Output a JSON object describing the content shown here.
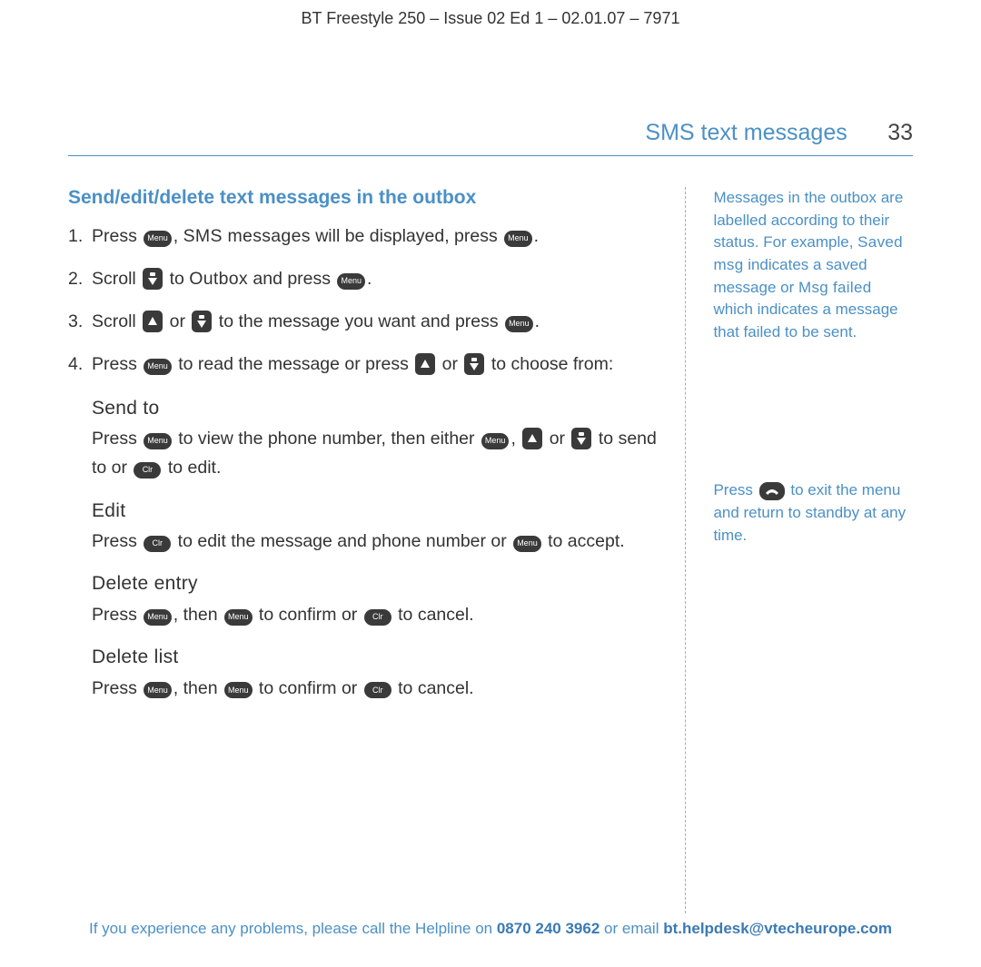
{
  "header": "BT Freestyle 250 – Issue 02 Ed 1 – 02.01.07 – 7971",
  "section": "SMS text messages",
  "page": "33",
  "title": "Send/edit/delete text messages in the outbox",
  "btn": {
    "menu": "Menu",
    "clr": "Clr"
  },
  "steps": {
    "s1a": "Press ",
    "s1b": ", ",
    "s1c": "SMS messages",
    "s1d": " will be displayed, press ",
    "s1e": ".",
    "s2a": "Scroll ",
    "s2b": " to ",
    "s2c": "Outbox",
    "s2d": " and press ",
    "s2e": ".",
    "s3a": "Scroll ",
    "s3b": " or ",
    "s3c": " to the message you want and press ",
    "s3d": ".",
    "s4a": "Press ",
    "s4b": " to read the message or press ",
    "s4c": " or ",
    "s4d": " to choose from:"
  },
  "sub": {
    "sendLabel": "Send  to",
    "send_a": "Press ",
    "send_b": " to view the phone number, then either ",
    "send_c": ", ",
    "send_d": " or ",
    "send_e": " to send to or ",
    "send_f": " to edit.",
    "editLabel": "Edit",
    "edit_a": "Press ",
    "edit_b": " to edit the message and phone number or ",
    "edit_c": " to accept.",
    "delEntryLabel": "Delete  entry",
    "de_a": "Press ",
    "de_b": ", then ",
    "de_c": " to confirm or ",
    "de_d": " to cancel.",
    "delListLabel": "Delete  list",
    "dl_a": "Press ",
    "dl_b": ", then ",
    "dl_c": " to confirm or ",
    "dl_d": " to cancel."
  },
  "side": {
    "n1a": "Messages in the outbox are labelled according to their status. For example, ",
    "n1b": "Saved msg",
    "n1c": " indicates a saved message or ",
    "n1d": "Msg failed",
    "n1e": "  which indicates a message that failed to be sent.",
    "n2a": "Press ",
    "n2b": " to exit the menu and return to standby at any time."
  },
  "footer": {
    "a": "If you experience any problems, please call the Helpline on ",
    "phone": "0870 240 3962",
    "b": " or email ",
    "email": "bt.helpdesk@vtecheurope.com"
  }
}
